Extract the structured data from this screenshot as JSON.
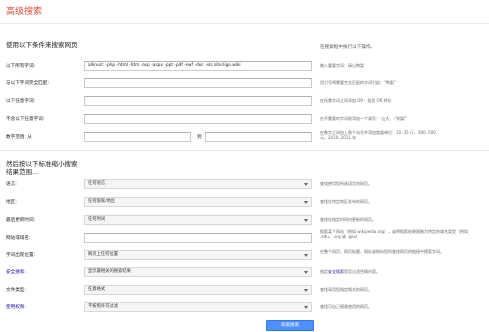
{
  "page_title": "高级搜索",
  "find_pages": {
    "heading": "使用以下条件来搜索网页",
    "hint": "在搜索框中执行以下操作。",
    "rows": [
      {
        "label": "以下所有字词:",
        "value": "allinurl: -php -html -htm -asp -aspx -ppt -pdf -swf -doc -xls site:ligo.wiki",
        "hint": "输入重要字词：砀山鸭梨"
      },
      {
        "label": "与以下字词完全匹配:",
        "value": "",
        "hint": "用引号将需要完全匹配的字词引起：\"鸭梨\""
      },
      {
        "label": "以下任意字词:",
        "value": "",
        "hint": "在所需字词之间添加 OR：批发 OR 特价"
      },
      {
        "label": "不含以下任意字词:",
        "value": "",
        "hint": "在不需要的字词前添加一个减号：-山大、-\"刺梨\""
      },
      {
        "label": "数字范围: 从",
        "value": "",
        "hint": "在数字之间加上两个句号并添加度量单位：10..35 斤、300..500 元、2010..2011 年"
      }
    ],
    "range_to": "到"
  },
  "narrow": {
    "heading": "然后按以下标准缩小搜索结果范围...",
    "rows": [
      {
        "label": "语言:",
        "value": "任何语言",
        "hint": "查找使用您所选语言的网页。",
        "link": false
      },
      {
        "label": "地区:",
        "value": "任何国家/地区",
        "hint": "查找在特定地区发布的网页。",
        "link": false
      },
      {
        "label": "最后更新时间:",
        "value": "任何时间",
        "hint": "查找在指定时间内更新的网页。",
        "link": false
      },
      {
        "label": "网站或域名:",
        "value": "",
        "hint": "搜索某个网站（例如 wikipedia.org），或将搜索结果限制为特定的域名类型（例如 .edu、.org 或 .gov）",
        "link": false
      },
      {
        "label": "字词出现位置:",
        "value": "网页上任何位置",
        "hint": "在整个网页、网页标题、网址或指向您所查找网页的链接中搜索字词。",
        "link": false
      },
      {
        "label": "安全搜索:",
        "value": "显示最相关的搜索结果",
        "hint": "",
        "hint_parts": [
          "指定",
          "安全搜索",
          "是否过滤色情内容。"
        ],
        "link": true
      },
      {
        "label": "文件类型:",
        "value": "任意格式",
        "hint": "查找采用您指定格式的网页。",
        "link": false
      },
      {
        "label": "使用权限:",
        "value": "不按照许可过滤",
        "hint": "查找可自己随意使用的网页。",
        "link": true
      }
    ]
  },
  "submit_label": "高级搜索"
}
